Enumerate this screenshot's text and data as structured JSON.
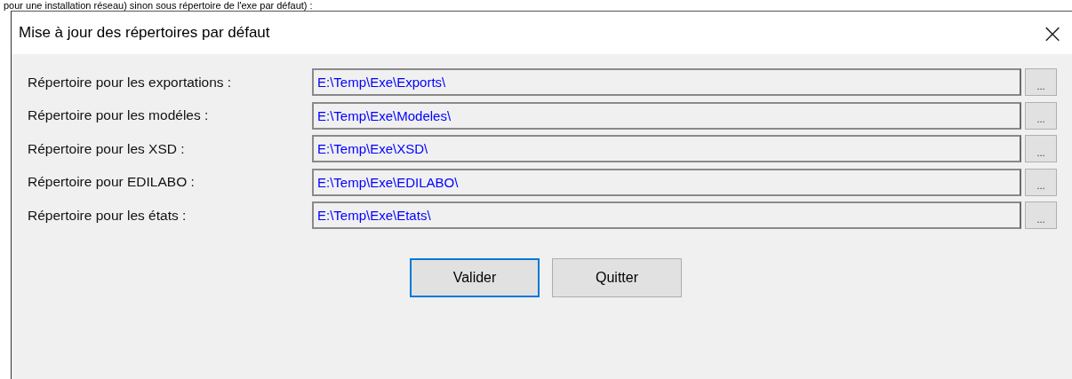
{
  "background_text": "pour une installation réseau) sinon sous répertoire de l'exe par défaut) :",
  "window": {
    "title": "Mise à jour des répertoires par défaut",
    "close": "×"
  },
  "rows": [
    {
      "label": "Répertoire pour les exportations :",
      "value": "E:\\Temp\\Exe\\Exports\\",
      "browse": "..."
    },
    {
      "label": "Répertoire pour les modéles :",
      "value": "E:\\Temp\\Exe\\Modeles\\",
      "browse": "..."
    },
    {
      "label": "Répertoire pour les XSD :",
      "value": "E:\\Temp\\Exe\\XSD\\",
      "browse": "..."
    },
    {
      "label": "Répertoire pour EDILABO :",
      "value": "E:\\Temp\\Exe\\EDILABO\\",
      "browse": "..."
    },
    {
      "label": "Répertoire pour les états :",
      "value": "E:\\Temp\\Exe\\Etats\\",
      "browse": "..."
    }
  ],
  "buttons": [
    {
      "label": "Valider",
      "focused": true
    },
    {
      "label": "Quitter",
      "focused": false
    }
  ]
}
